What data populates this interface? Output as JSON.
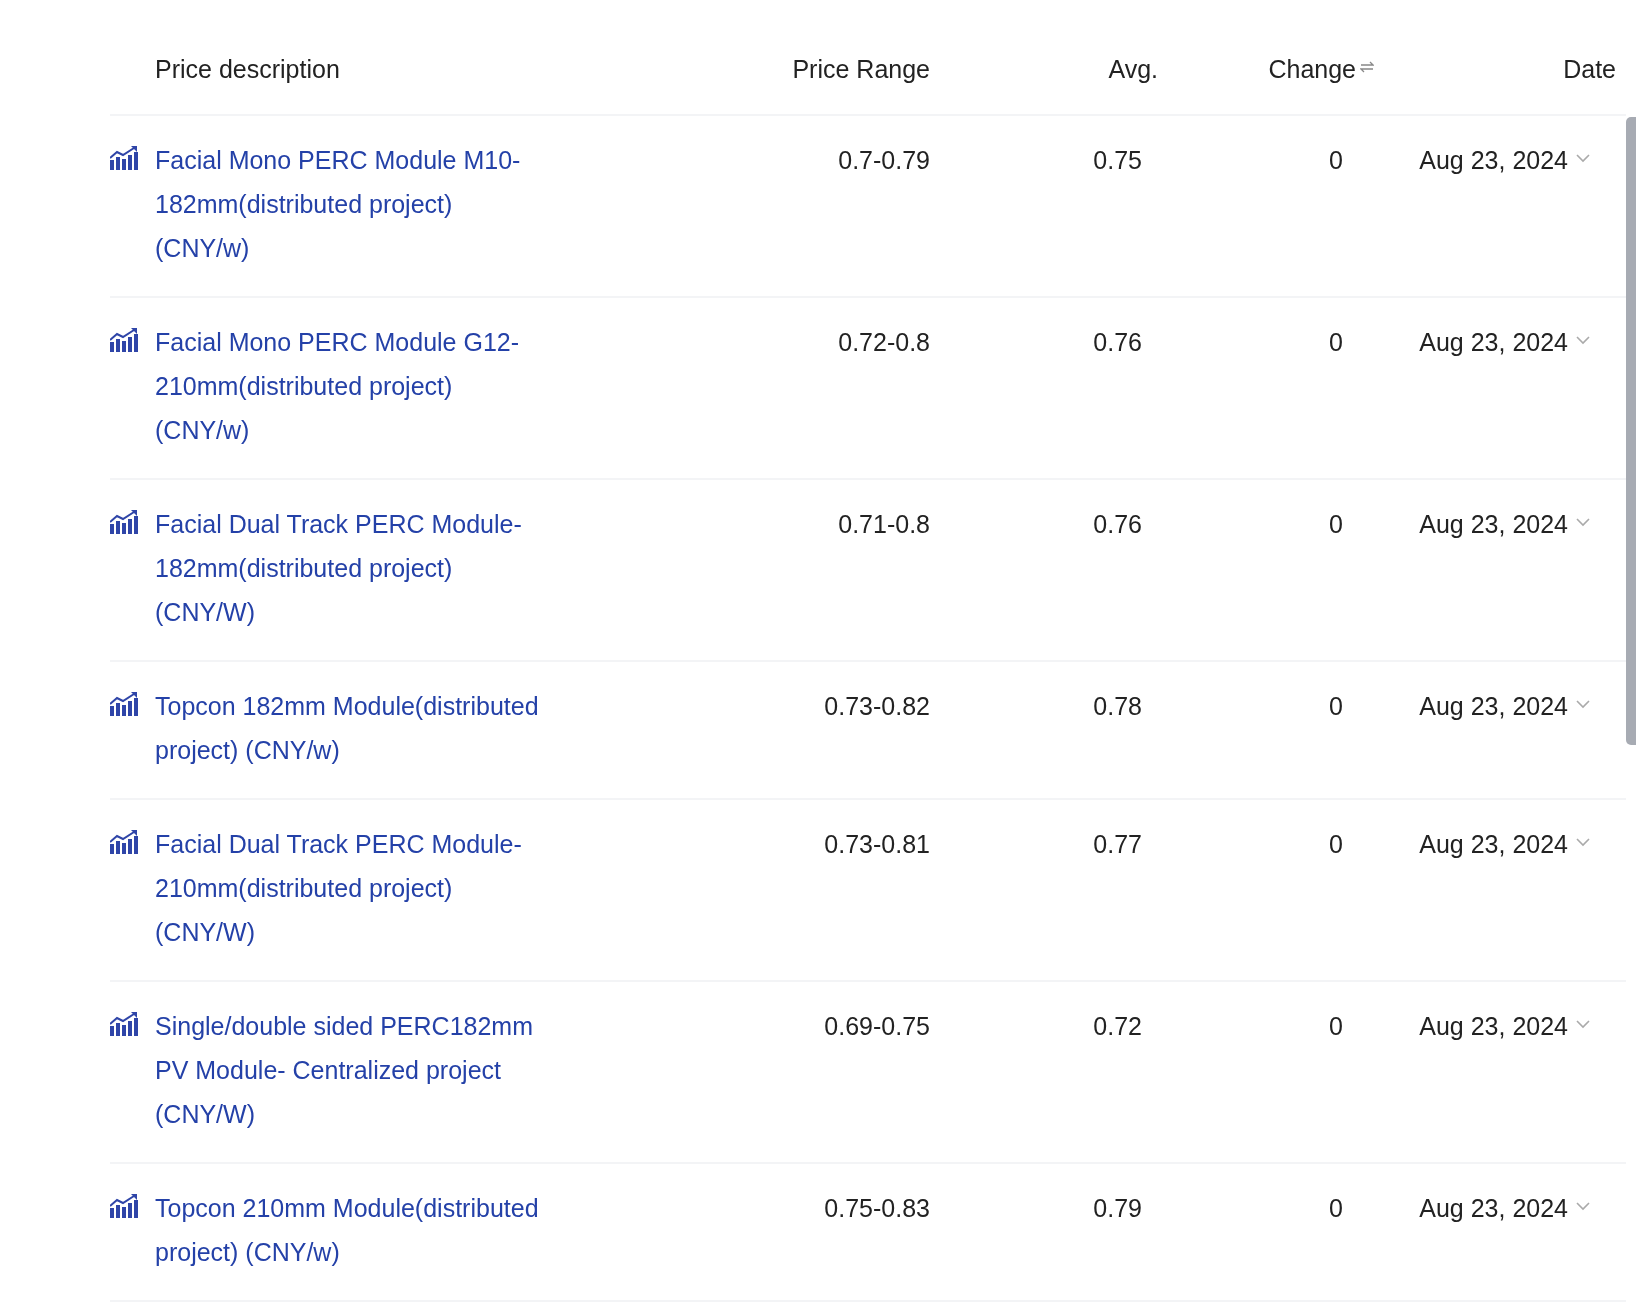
{
  "table": {
    "columns": [
      {
        "label": "Price description",
        "sortable": false
      },
      {
        "label": "Price Range",
        "sortable": false
      },
      {
        "label": "Avg.",
        "sortable": false
      },
      {
        "label": "Change",
        "sortable": true
      },
      {
        "label": "Date",
        "sortable": false
      }
    ],
    "rows": [
      {
        "description": "Facial Mono PERC Module M10-182mm(distributed project) (CNY/w)",
        "range": "0.7-0.79",
        "avg": "0.75",
        "change": "0",
        "date": "Aug 23, 2024"
      },
      {
        "description": "Facial Mono PERC Module G12-210mm(distributed project) (CNY/w)",
        "range": "0.72-0.8",
        "avg": "0.76",
        "change": "0",
        "date": "Aug 23, 2024"
      },
      {
        "description": "Facial Dual Track PERC Module-182mm(distributed project) (CNY/W)",
        "range": "0.71-0.8",
        "avg": "0.76",
        "change": "0",
        "date": "Aug 23, 2024"
      },
      {
        "description": "Topcon 182mm Module(distributed project) (CNY/w)",
        "range": "0.73-0.82",
        "avg": "0.78",
        "change": "0",
        "date": "Aug 23, 2024"
      },
      {
        "description": "Facial Dual Track PERC Module-210mm(distributed project) (CNY/W)",
        "range": "0.73-0.81",
        "avg": "0.77",
        "change": "0",
        "date": "Aug 23, 2024"
      },
      {
        "description": "Single/double sided PERC182mm PV Module- Centralized project (CNY/W)",
        "range": "0.69-0.75",
        "avg": "0.72",
        "change": "0",
        "date": "Aug 23, 2024"
      },
      {
        "description": "Topcon 210mm Module(distributed project) (CNY/w)",
        "range": "0.75-0.83",
        "avg": "0.79",
        "change": "0",
        "date": "Aug 23, 2024"
      }
    ]
  }
}
